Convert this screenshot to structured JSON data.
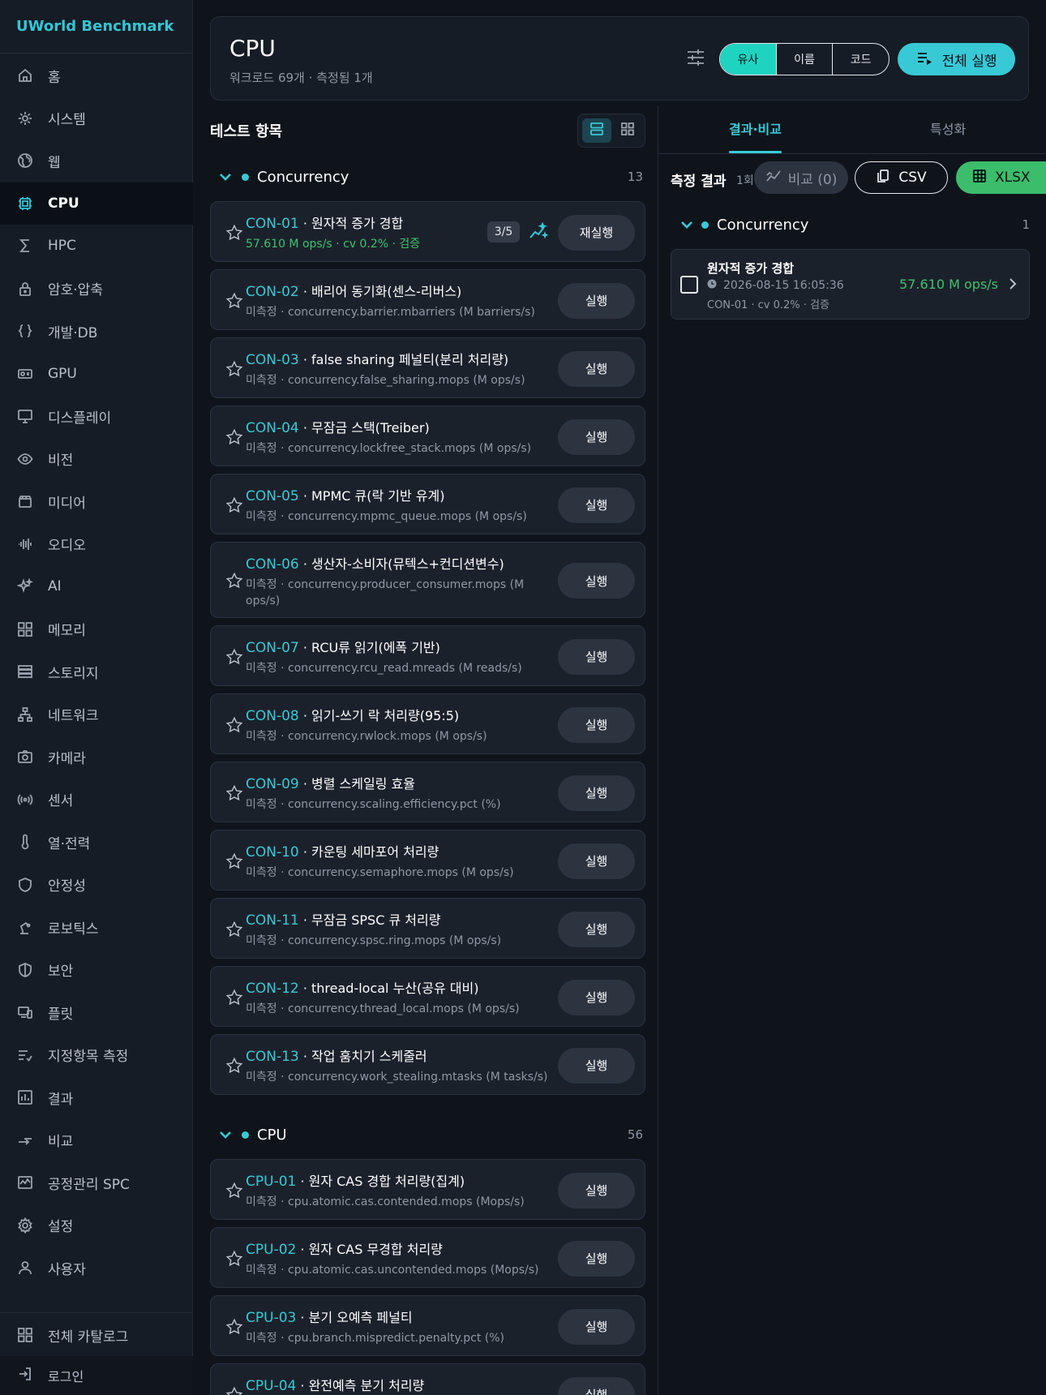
{
  "brand": "UWorld Benchmark",
  "sidebar": {
    "items": [
      {
        "label": "홈",
        "icon": "home-icon"
      },
      {
        "label": "시스템",
        "icon": "system-gear-icon"
      },
      {
        "label": "웹",
        "icon": "globe-icon"
      },
      {
        "label": "CPU",
        "icon": "cpu-icon",
        "active": true
      },
      {
        "label": "HPC",
        "icon": "sigma-icon"
      },
      {
        "label": "암호·압축",
        "icon": "lock-icon"
      },
      {
        "label": "개발·DB",
        "icon": "braces-icon"
      },
      {
        "label": "GPU",
        "icon": "gpu-icon"
      },
      {
        "label": "디스플레이",
        "icon": "monitor-icon"
      },
      {
        "label": "비전",
        "icon": "eye-icon"
      },
      {
        "label": "미디어",
        "icon": "clapper-icon"
      },
      {
        "label": "오디오",
        "icon": "waveform-icon"
      },
      {
        "label": "AI",
        "icon": "sparkle-icon"
      },
      {
        "label": "메모리",
        "icon": "grid-icon"
      },
      {
        "label": "스토리지",
        "icon": "storage-icon"
      },
      {
        "label": "네트워크",
        "icon": "network-icon"
      },
      {
        "label": "카메라",
        "icon": "camera-icon"
      },
      {
        "label": "센서",
        "icon": "sensor-icon"
      },
      {
        "label": "열·전력",
        "icon": "thermometer-icon"
      },
      {
        "label": "안정성",
        "icon": "shield-icon"
      },
      {
        "label": "로보틱스",
        "icon": "robot-arm-icon"
      },
      {
        "label": "보안",
        "icon": "security-shield-icon"
      },
      {
        "label": "플릿",
        "icon": "devices-icon"
      },
      {
        "label": "지정항목 측정",
        "icon": "checklist-icon"
      },
      {
        "label": "결과",
        "icon": "bar-chart-icon"
      },
      {
        "label": "비교",
        "icon": "compare-arrows-icon"
      },
      {
        "label": "공정관리 SPC",
        "icon": "spc-chart-icon"
      },
      {
        "label": "설정",
        "icon": "settings-icon"
      },
      {
        "label": "사용자",
        "icon": "user-icon"
      }
    ],
    "catalog": {
      "label": "전체 카탈로그",
      "icon": "grid-icon"
    },
    "login": {
      "label": "로그인",
      "icon": "login-icon"
    }
  },
  "header": {
    "title": "CPU",
    "subtitle": "워크로드 69개 · 측정됨 1개",
    "sort": [
      "유사",
      "이름",
      "코드"
    ],
    "sort_selected": "유사",
    "run_all": "전체 실행"
  },
  "tests": {
    "title": "테스트 항목",
    "groups": [
      {
        "name": "Concurrency",
        "count": "13",
        "items": [
          {
            "code": "CON-01",
            "name": "원자적 증가 경합",
            "meta": "57.610 M ops/s  ·  cv 0.2%  ·  검증",
            "measured": true,
            "badge": "3/5",
            "button": "재실행"
          },
          {
            "code": "CON-02",
            "name": "배리어 동기화(센스-리버스)",
            "meta": "미측정  ·  concurrency.barrier.mbarriers (M barriers/s)",
            "button": "실행"
          },
          {
            "code": "CON-03",
            "name": "false sharing 페널티(분리 처리량)",
            "meta": "미측정  ·  concurrency.false_sharing.mops (M ops/s)",
            "button": "실행"
          },
          {
            "code": "CON-04",
            "name": "무잠금 스택(Treiber)",
            "meta": "미측정  ·  concurrency.lockfree_stack.mops (M ops/s)",
            "button": "실행"
          },
          {
            "code": "CON-05",
            "name": "MPMC 큐(락 기반 유계)",
            "meta": "미측정  ·  concurrency.mpmc_queue.mops (M ops/s)",
            "button": "실행"
          },
          {
            "code": "CON-06",
            "name": "생산자-소비자(뮤텍스+컨디션변수)",
            "meta": "미측정  ·  concurrency.producer_consumer.mops (M ops/s)",
            "button": "실행",
            "tall": true
          },
          {
            "code": "CON-07",
            "name": "RCU류 읽기(에폭 기반)",
            "meta": "미측정  ·  concurrency.rcu_read.mreads (M reads/s)",
            "button": "실행"
          },
          {
            "code": "CON-08",
            "name": "읽기-쓰기 락 처리량(95:5)",
            "meta": "미측정  ·  concurrency.rwlock.mops (M ops/s)",
            "button": "실행"
          },
          {
            "code": "CON-09",
            "name": "병렬 스케일링 효율",
            "meta": "미측정  ·  concurrency.scaling.efficiency.pct (%)",
            "button": "실행"
          },
          {
            "code": "CON-10",
            "name": "카운팅 세마포어 처리량",
            "meta": "미측정  ·  concurrency.semaphore.mops (M ops/s)",
            "button": "실행"
          },
          {
            "code": "CON-11",
            "name": "무잠금 SPSC 큐 처리량",
            "meta": "미측정  ·  concurrency.spsc.ring.mops (M ops/s)",
            "button": "실행"
          },
          {
            "code": "CON-12",
            "name": "thread-local 누산(공유 대비)",
            "meta": "미측정  ·  concurrency.thread_local.mops (M ops/s)",
            "button": "실행"
          },
          {
            "code": "CON-13",
            "name": "작업 훔치기 스케줄러",
            "meta": "미측정  ·  concurrency.work_stealing.mtasks (M tasks/s)",
            "button": "실행"
          }
        ]
      },
      {
        "name": "CPU",
        "count": "56",
        "items": [
          {
            "code": "CPU-01",
            "name": "원자 CAS 경합 처리량(집계)",
            "meta": "미측정  ·  cpu.atomic.cas.contended.mops (Mops/s)",
            "button": "실행"
          },
          {
            "code": "CPU-02",
            "name": "원자 CAS 무경합 처리량",
            "meta": "미측정  ·  cpu.atomic.cas.uncontended.mops (Mops/s)",
            "button": "실행"
          },
          {
            "code": "CPU-03",
            "name": "분기 오예측 페널티",
            "meta": "미측정  ·  cpu.branch.mispredict.penalty.pct (%)",
            "button": "실행"
          },
          {
            "code": "CPU-04",
            "name": "완전예측 분기 처리량",
            "meta": "",
            "button": "실행"
          }
        ]
      }
    ]
  },
  "right": {
    "tabs": [
      "결과·비교",
      "특성화"
    ],
    "active_tab": "결과·비교",
    "results_title": "측정 결과",
    "results_count": "1회",
    "compare_label": "비교 (0)",
    "csv_label": "CSV",
    "xlsx_label": "XLSX",
    "group": {
      "name": "Concurrency",
      "count": "1"
    },
    "result": {
      "name": "원자적 증가 경합",
      "time": "2026-08-15 16:05:36",
      "meta": "CON-01 · cv 0.2% · 검증",
      "value": "57.610 M ops/s"
    }
  },
  "colors": {
    "accent": "#38c9d6",
    "ok": "#3dc46c",
    "xlsx": "#3bbd6b"
  }
}
